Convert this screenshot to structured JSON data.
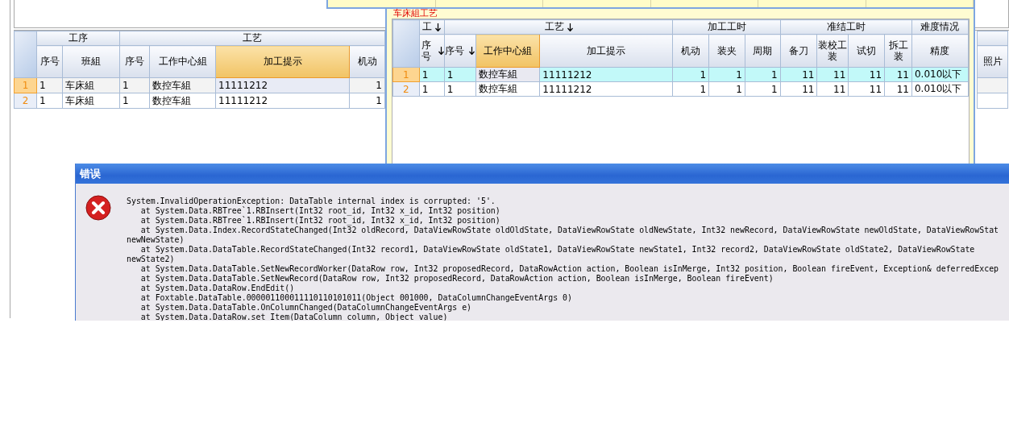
{
  "main_grid": {
    "column_groups": [
      {
        "label": "工序",
        "columns": [
          {
            "label": "序号",
            "kind": "text",
            "selected": false
          },
          {
            "label": "班組",
            "kind": "text",
            "selected": false
          }
        ]
      },
      {
        "label": "工艺",
        "columns": [
          {
            "label": "序号",
            "kind": "text",
            "selected": false
          },
          {
            "label": "工作中心組",
            "kind": "text",
            "selected": false
          },
          {
            "label": "加工提示",
            "kind": "text",
            "selected": true
          },
          {
            "label": "机动",
            "kind": "number",
            "selected": false
          }
        ]
      },
      {
        "columns": [
          {
            "label": "照片",
            "kind": "text",
            "selected": false
          }
        ]
      }
    ],
    "rows": [
      {
        "number": "1",
        "selected": true,
        "cells": [
          "1",
          "车床組",
          "1",
          "数控车組",
          "11111212",
          "1"
        ]
      },
      {
        "number": "2",
        "selected": false,
        "cells": [
          "1",
          "车床組",
          "1",
          "数控车組",
          "11111212",
          "1"
        ]
      }
    ]
  },
  "process_window": {
    "title": "车床組工艺",
    "grid": {
      "column_groups": [
        {
          "label": "工",
          "sorted": true,
          "columns": [
            {
              "label": "序号",
              "kind": "text",
              "sorted": true,
              "selected": false
            }
          ]
        },
        {
          "label": "工艺",
          "sorted": true,
          "columns": [
            {
              "label": "序号",
              "kind": "text",
              "sorted": true,
              "selected": false
            },
            {
              "label": "工作中心組",
              "kind": "text",
              "sorted": false,
              "selected": true
            },
            {
              "label": "加工提示",
              "kind": "text",
              "sorted": false,
              "selected": false
            }
          ]
        },
        {
          "label": "加工工时",
          "sorted": false,
          "columns": [
            {
              "label": "机动",
              "kind": "number",
              "sorted": false,
              "selected": false
            },
            {
              "label": "装夹",
              "kind": "number",
              "sorted": false,
              "selected": false
            },
            {
              "label": "周期",
              "kind": "number",
              "sorted": false,
              "selected": false
            }
          ]
        },
        {
          "label": "准结工时",
          "sorted": false,
          "columns": [
            {
              "label": "备刀",
              "kind": "number",
              "sorted": false,
              "selected": false
            },
            {
              "label": "装校工装",
              "kind": "number",
              "sorted": false,
              "selected": false
            },
            {
              "label": "试切",
              "kind": "number",
              "sorted": false,
              "selected": false
            },
            {
              "label": "拆工装",
              "kind": "number",
              "sorted": false,
              "selected": false
            }
          ]
        },
        {
          "label": "难度情况",
          "sorted": false,
          "columns": [
            {
              "label": "精度",
              "kind": "text",
              "sorted": false,
              "selected": false
            }
          ]
        }
      ],
      "rows": [
        {
          "number": "1",
          "selected": true,
          "cells": [
            "1",
            "1",
            "数控车組",
            "11111212",
            "1",
            "1",
            "1",
            "11",
            "11",
            "11",
            "11",
            "0.010以下"
          ]
        },
        {
          "number": "2",
          "selected": false,
          "cells": [
            "1",
            "1",
            "数控车組",
            "11111212",
            "1",
            "1",
            "1",
            "11",
            "11",
            "11",
            "11",
            "0.010以下"
          ]
        }
      ]
    }
  },
  "error_dialog": {
    "title": "错误",
    "message_lines": [
      "System.InvalidOperationException: DataTable internal index is corrupted: '5'.",
      "   at System.Data.RBTree`1.RBInsert(Int32 root_id, Int32 x_id, Int32 position)",
      "   at System.Data.RBTree`1.RBInsert(Int32 root_id, Int32 x_id, Int32 position)",
      "   at System.Data.Index.RecordStateChanged(Int32 oldRecord, DataViewRowState oldOldState, DataViewRowState oldNewState, Int32 newRecord, DataViewRowState newOldState, DataViewRowStat",
      "newNewState)",
      "   at System.Data.DataTable.RecordStateChanged(Int32 record1, DataViewRowState oldState1, DataViewRowState newState1, Int32 record2, DataViewRowState oldState2, DataViewRowState",
      "newState2)",
      "   at System.Data.DataTable.SetNewRecordWorker(DataRow row, Int32 proposedRecord, DataRowAction action, Boolean isInMerge, Int32 position, Boolean fireEvent, Exception& deferredExcep",
      "   at System.Data.DataTable.SetNewRecord(DataRow row, Int32 proposedRecord, DataRowAction action, Boolean isInMerge, Boolean fireEvent)",
      "   at System.Data.DataRow.EndEdit()",
      "   at Foxtable.DataTable.000001100011110110101011(Object 001000, DataColumnChangeEventArgs 0)",
      "   at System.Data.DataTable.OnColumnChanged(DataColumnChangeEventArgs e)",
      "   at System.Data.DataRow.set Item(DataColumn column, Object value)"
    ]
  }
}
